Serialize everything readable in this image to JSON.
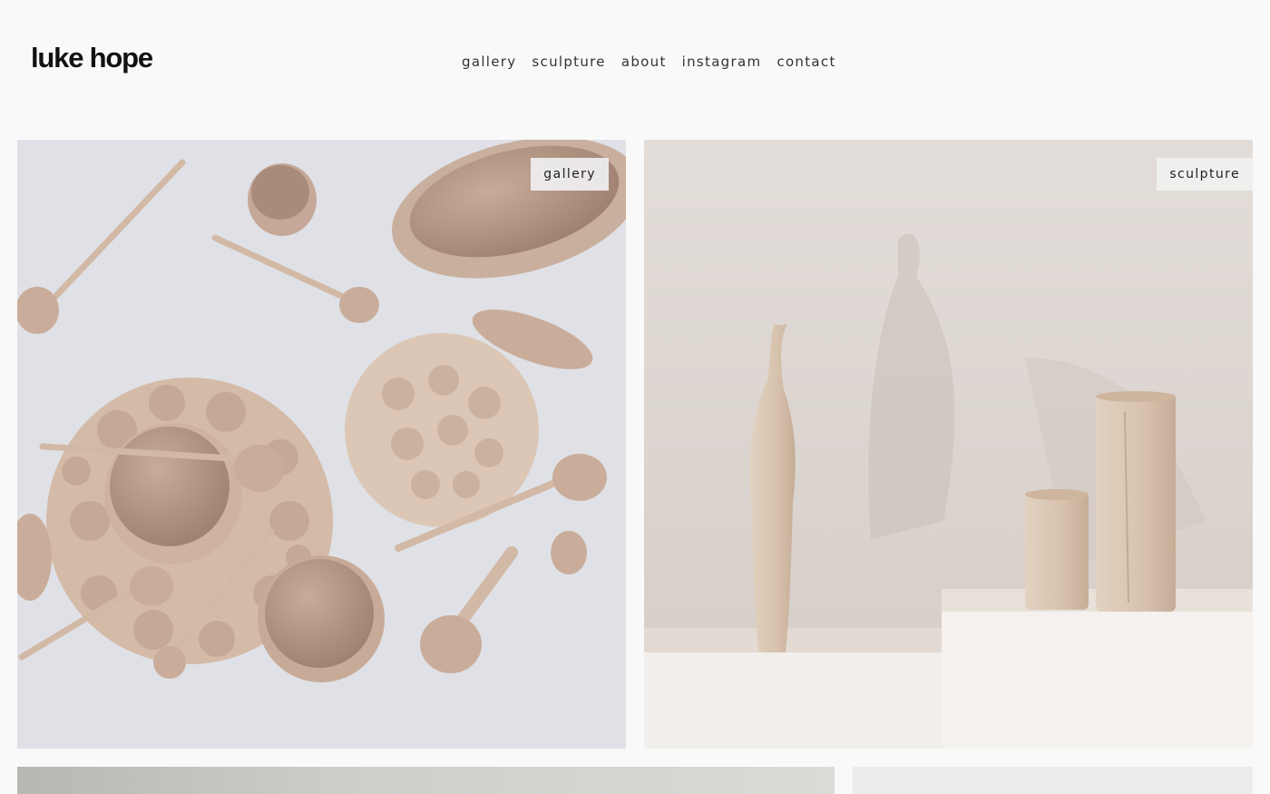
{
  "site": {
    "logo": "luke hope"
  },
  "nav": [
    {
      "label": "gallery"
    },
    {
      "label": "sculpture"
    },
    {
      "label": "about"
    },
    {
      "label": "instagram"
    },
    {
      "label": "contact"
    }
  ],
  "tiles": [
    {
      "badge": "gallery"
    },
    {
      "badge": "sculpture"
    }
  ]
}
